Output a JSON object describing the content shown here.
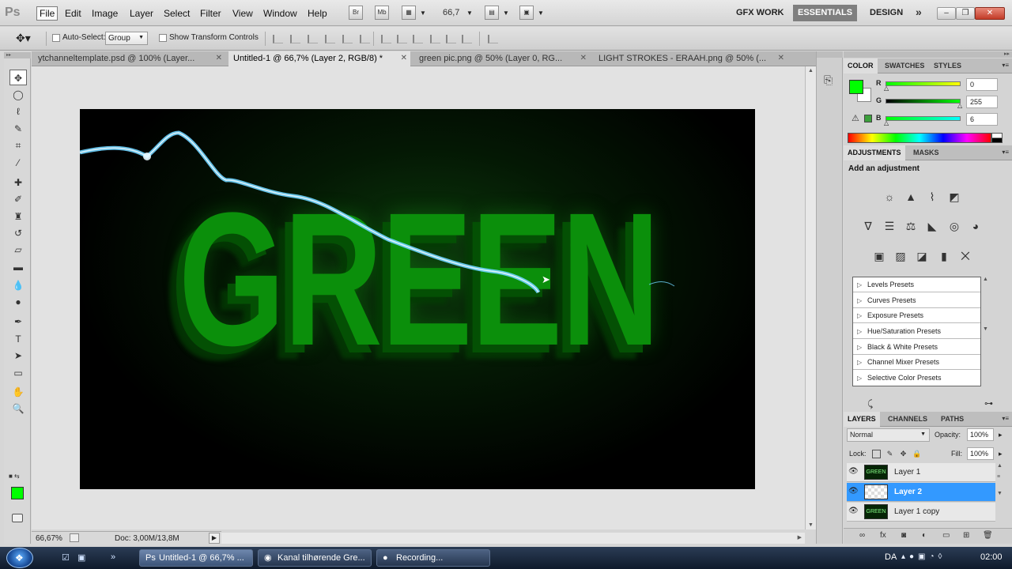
{
  "app": {
    "logo": "Ps"
  },
  "menu": {
    "items": [
      "File",
      "Edit",
      "Image",
      "Layer",
      "Select",
      "Filter",
      "View",
      "Window",
      "Help"
    ],
    "bridge": "Br",
    "minibridge": "Mb",
    "zoom": "66,7"
  },
  "workspaces": {
    "items": [
      "GFX WORK",
      "ESSENTIALS",
      "DESIGN"
    ],
    "active": "ESSENTIALS",
    "more": "»"
  },
  "options": {
    "auto_select_label": "Auto-Select:",
    "auto_select_value": "Group",
    "show_transform_label": "Show Transform Controls"
  },
  "doc_tabs": [
    {
      "label": "ytchanneltemplate.psd @ 100% (Layer...",
      "active": false
    },
    {
      "label": "Untitled-1 @ 66,7% (Layer 2, RGB/8) *",
      "active": true
    },
    {
      "label": "green pic.png @ 50% (Layer 0, RG...",
      "active": false
    },
    {
      "label": "LIGHT STROKES - ERAAH.png @ 50% (...",
      "active": false
    }
  ],
  "canvas": {
    "text": "GREEN"
  },
  "status": {
    "zoom": "66,67%",
    "doc": "Doc: 3,00M/13,8M"
  },
  "color_panel": {
    "tabs": [
      "COLOR",
      "SWATCHES",
      "STYLES"
    ],
    "active_tab": "COLOR",
    "channels": [
      {
        "label": "R",
        "value": "0"
      },
      {
        "label": "G",
        "value": "255"
      },
      {
        "label": "B",
        "value": "6"
      }
    ],
    "fg_color": "#00ff00"
  },
  "adjustments": {
    "tabs": [
      "ADJUSTMENTS",
      "MASKS"
    ],
    "active_tab": "ADJUSTMENTS",
    "title": "Add an adjustment",
    "presets": [
      "Levels Presets",
      "Curves Presets",
      "Exposure Presets",
      "Hue/Saturation Presets",
      "Black & White Presets",
      "Channel Mixer Presets",
      "Selective Color Presets"
    ]
  },
  "layers_panel": {
    "tabs": [
      "LAYERS",
      "CHANNELS",
      "PATHS"
    ],
    "active_tab": "LAYERS",
    "blend_mode": "Normal",
    "opacity_label": "Opacity:",
    "opacity": "100%",
    "lock_label": "Lock:",
    "fill_label": "Fill:",
    "fill": "100%",
    "layers": [
      {
        "name": "Layer 1",
        "thumb": "GREEN",
        "selected": false
      },
      {
        "name": "Layer 2",
        "thumb": "",
        "selected": true
      },
      {
        "name": "Layer 1 copy",
        "thumb": "GREEN",
        "selected": false
      }
    ]
  },
  "taskbar": {
    "items": [
      {
        "label": "Untitled-1 @ 66,7% ...",
        "icon": "photoshop-icon",
        "active": true
      },
      {
        "label": "Kanal tilhørende Gre...",
        "icon": "firefox-icon",
        "active": false
      },
      {
        "label": "Recording...",
        "icon": "recorder-icon",
        "active": false
      }
    ],
    "lang": "DA",
    "clock": "02:00"
  }
}
